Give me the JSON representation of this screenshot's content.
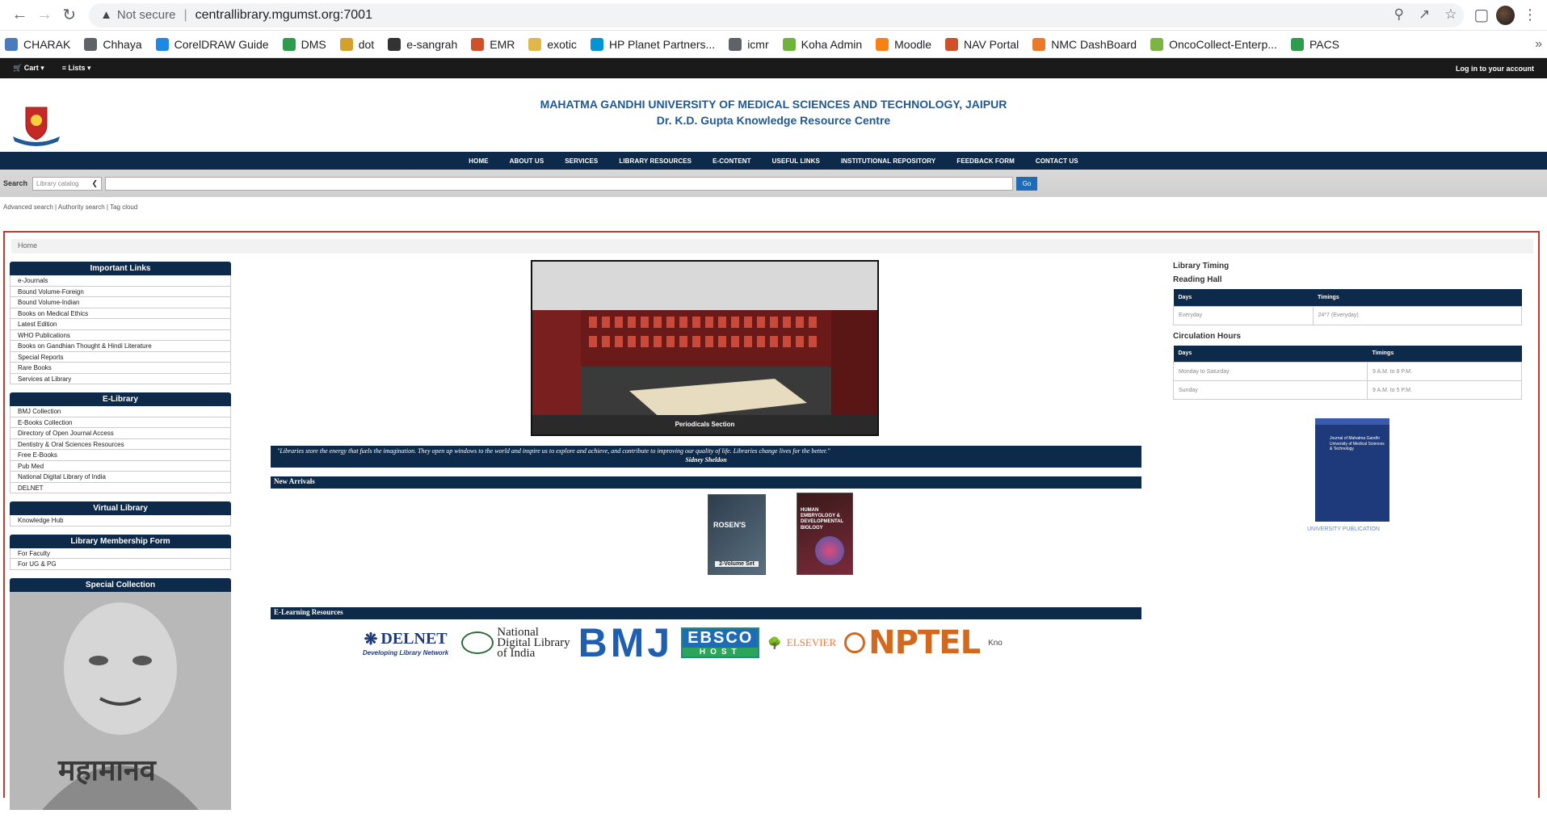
{
  "browser": {
    "security": "Not secure",
    "url": "centrallibrary.mgumst.org:7001"
  },
  "bookmarks": [
    {
      "label": "CHARAK",
      "color": "#4a7bbd"
    },
    {
      "label": "Chhaya",
      "color": "#5f6368"
    },
    {
      "label": "CorelDRAW Guide",
      "color": "#1e88e5"
    },
    {
      "label": "DMS",
      "color": "#2e9b4e"
    },
    {
      "label": "dot",
      "color": "#d4a22a"
    },
    {
      "label": "e-sangrah",
      "color": "#333333"
    },
    {
      "label": "EMR",
      "color": "#d0502a"
    },
    {
      "label": "exotic",
      "color": "#e0b84a"
    },
    {
      "label": "HP Planet Partners...",
      "color": "#0096d6"
    },
    {
      "label": "icmr",
      "color": "#5f6368"
    },
    {
      "label": "Koha Admin",
      "color": "#6fb33b"
    },
    {
      "label": "Moodle",
      "color": "#f98012"
    },
    {
      "label": "NAV Portal",
      "color": "#d0502a"
    },
    {
      "label": "NMC DashBoard",
      "color": "#e87a2a"
    },
    {
      "label": "OncoCollect-Enterp...",
      "color": "#7cb342"
    },
    {
      "label": "PACS",
      "color": "#2e9b4e"
    }
  ],
  "topbar": {
    "cart": "Cart",
    "lists": "Lists",
    "login": "Log in to your account"
  },
  "header": {
    "title1": "MAHATMA GANDHI UNIVERSITY OF MEDICAL SCIENCES AND TECHNOLOGY, JAIPUR",
    "title2": "Dr. K.D. Gupta Knowledge Resource Centre"
  },
  "mainnav": [
    "HOME",
    "ABOUT US",
    "SERVICES",
    "LIBRARY RESOURCES",
    "E-CONTENT",
    "USEFUL LINKS",
    "INSTITUTIONAL REPOSITORY",
    "FEEDBACK FORM",
    "CONTACT US"
  ],
  "search": {
    "label": "Search",
    "scope": "Library catalog",
    "go": "Go",
    "advanced": "Advanced search | Authority search | Tag cloud"
  },
  "breadcrumb": "Home",
  "left": {
    "important": {
      "title": "Important Links",
      "items": [
        "e-Journals",
        "Bound Volume-Foreign",
        "Bound Volume-Indian",
        "Books on Medical Ethics",
        "Latest Edition",
        "WHO Publications",
        "Books on Gandhian Thought & Hindi Literature",
        "Special Reports",
        "Rare Books",
        "Services at Library"
      ]
    },
    "elibrary": {
      "title": "E-Library",
      "items": [
        "BMJ Collection",
        "E-Books Collection",
        "Directory of Open Journal Access",
        "Dentistry & Oral Sciences Resources",
        "Free E-Books",
        "Pub Med",
        "National Digital Library of India",
        "DELNET"
      ]
    },
    "virtual": {
      "title": "Virtual Library",
      "items": [
        "Knowledge Hub"
      ]
    },
    "membership": {
      "title": "Library Membership Form",
      "items": [
        "For Faculty",
        "For UG & PG"
      ]
    },
    "special": {
      "title": "Special Collection",
      "caption": "महामानव"
    }
  },
  "center": {
    "hero_caption": "Periodicals Section",
    "quote": "\"Libraries store the energy that fuels the imagination. They open up windows to the world and inspire us to explore and achieve, and contribute to improving our quality of life. Libraries change lives for the better.\"",
    "quote_author": "Sidney Sheldon",
    "new_arrivals": "New Arrivals",
    "book1_title": "ROSEN'S",
    "book1_sub": "2-Volume Set",
    "book2_title": "HUMAN EMBRYOLOGY & DEVELOPMENTAL BIOLOGY",
    "elearning": "E-Learning Resources",
    "logos": {
      "delnet": "DELNET",
      "delnet_sub": "Developing Library Network",
      "ndl1": "National",
      "ndl2": "Digital Library",
      "ndl3": "of India",
      "bmj": "BMJ",
      "ebsco": "EBSCO",
      "ebsco_sub": "HOST",
      "elsevier": "ELSEVIER",
      "nptel": "NPTEL",
      "kno": "Kno"
    }
  },
  "right": {
    "timing_title": "Library Timing",
    "reading_hall": "Reading Hall",
    "reading_table": {
      "headers": [
        "Days",
        "Timings"
      ],
      "rows": [
        [
          "Everyday",
          "24*7 (Everyday)"
        ]
      ]
    },
    "circulation": "Circulation Hours",
    "circ_table": {
      "headers": [
        "Days",
        "Timings"
      ],
      "rows": [
        [
          "Monday to Saturday",
          "9 A.M. to 8 P.M."
        ],
        [
          "Sunday",
          "9 A.M. to 5 P.M."
        ]
      ]
    },
    "pub_title": "Journal of Mahatma Gandhi University of Medical Sciences & Technology",
    "pub_caption": "UNIVERSITY PUBLICATION"
  }
}
